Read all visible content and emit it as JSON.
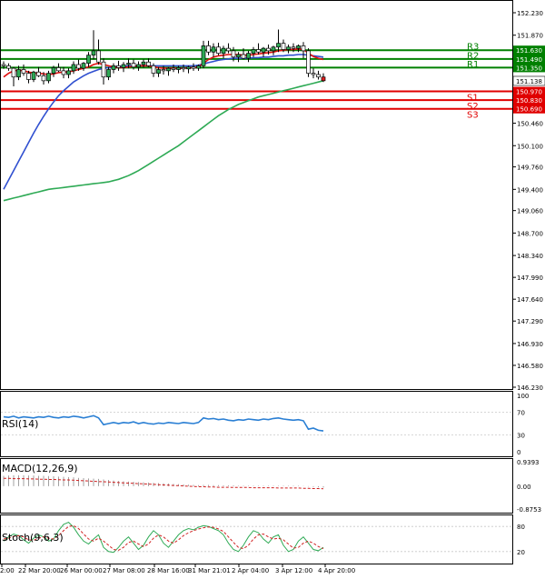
{
  "chart_data": {
    "type": "candlestick",
    "symbol": "USDJPY",
    "price_axis": {
      "ylim": [
        146.23,
        152.23
      ],
      "ticks": [
        "152.230",
        "151.870",
        "151.490",
        "151.130",
        "150.800",
        "150.460",
        "150.100",
        "149.760",
        "149.400",
        "149.060",
        "148.700",
        "148.340",
        "147.990",
        "147.640",
        "147.290",
        "146.930",
        "146.580",
        "146.230"
      ]
    },
    "time_labels": [
      "2:00",
      "22 Mar 20:00",
      "26 Mar 00:00",
      "27 Mar 08:00",
      "28 Mar 16:00",
      "31 Mar 21:01",
      "2 Apr 04:00",
      "3 Apr 12:00",
      "4 Apr 20:00"
    ],
    "levels": [
      {
        "name": "R3",
        "value": 151.63,
        "value_label": "151.630",
        "color": "#008000"
      },
      {
        "name": "R2",
        "value": 151.49,
        "value_label": "151.490",
        "color": "#008000"
      },
      {
        "name": "R1",
        "value": 151.35,
        "value_label": "151.350",
        "color": "#008000"
      },
      {
        "name": "S1",
        "value": 150.97,
        "value_label": "150.970",
        "color": "#e00000"
      },
      {
        "name": "S2",
        "value": 150.83,
        "value_label": "150.830",
        "color": "#e00000"
      },
      {
        "name": "S3",
        "value": 150.69,
        "value_label": "150.690",
        "color": "#e00000"
      }
    ],
    "last_price": {
      "value": 151.138,
      "label": "151.138"
    },
    "candles": [
      [
        151.4,
        151.45,
        151.33,
        151.38
      ],
      [
        151.38,
        151.42,
        151.3,
        151.34
      ],
      [
        151.34,
        151.36,
        151.05,
        151.2
      ],
      [
        151.2,
        151.38,
        151.15,
        151.32
      ],
      [
        151.32,
        151.4,
        151.22,
        151.26
      ],
      [
        151.26,
        151.3,
        151.1,
        151.16
      ],
      [
        151.16,
        151.3,
        151.12,
        151.28
      ],
      [
        151.28,
        151.36,
        151.2,
        151.22
      ],
      [
        151.22,
        151.28,
        151.08,
        151.14
      ],
      [
        151.14,
        151.3,
        151.1,
        151.26
      ],
      [
        151.26,
        151.38,
        151.2,
        151.35
      ],
      [
        151.35,
        151.42,
        151.28,
        151.3
      ],
      [
        151.3,
        151.36,
        151.18,
        151.24
      ],
      [
        151.24,
        151.34,
        151.18,
        151.3
      ],
      [
        151.3,
        151.45,
        151.25,
        151.4
      ],
      [
        151.4,
        151.48,
        151.3,
        151.34
      ],
      [
        151.34,
        151.44,
        151.3,
        151.42
      ],
      [
        151.42,
        151.6,
        151.36,
        151.55
      ],
      [
        151.55,
        151.95,
        151.48,
        151.62
      ],
      [
        151.62,
        151.8,
        151.4,
        151.44
      ],
      [
        151.44,
        151.5,
        151.08,
        151.2
      ],
      [
        151.2,
        151.36,
        151.15,
        151.32
      ],
      [
        151.32,
        151.42,
        151.26,
        151.38
      ],
      [
        151.38,
        151.46,
        151.3,
        151.35
      ],
      [
        151.35,
        151.44,
        151.28,
        151.4
      ],
      [
        151.4,
        151.5,
        151.34,
        151.42
      ],
      [
        151.42,
        151.48,
        151.32,
        151.36
      ],
      [
        151.36,
        151.45,
        151.3,
        151.4
      ],
      [
        151.4,
        151.48,
        151.35,
        151.44
      ],
      [
        151.44,
        151.5,
        151.36,
        151.38
      ],
      [
        151.38,
        151.42,
        151.2,
        151.26
      ],
      [
        151.26,
        151.36,
        151.2,
        151.32
      ],
      [
        151.32,
        151.38,
        151.24,
        151.3
      ],
      [
        151.3,
        151.36,
        151.22,
        151.34
      ],
      [
        151.34,
        151.4,
        151.28,
        151.32
      ],
      [
        151.32,
        151.38,
        151.26,
        151.35
      ],
      [
        151.35,
        151.4,
        151.28,
        151.33
      ],
      [
        151.33,
        151.38,
        151.26,
        151.36
      ],
      [
        151.36,
        151.42,
        151.3,
        151.34
      ],
      [
        151.34,
        151.4,
        151.3,
        151.38
      ],
      [
        151.38,
        151.78,
        151.34,
        151.7
      ],
      [
        151.7,
        151.78,
        151.55,
        151.6
      ],
      [
        151.6,
        151.74,
        151.52,
        151.68
      ],
      [
        151.68,
        151.75,
        151.55,
        151.58
      ],
      [
        151.58,
        151.7,
        151.5,
        151.66
      ],
      [
        151.66,
        151.74,
        151.58,
        151.62
      ],
      [
        151.62,
        151.68,
        151.45,
        151.52
      ],
      [
        151.52,
        151.6,
        151.44,
        151.56
      ],
      [
        151.56,
        151.66,
        151.48,
        151.5
      ],
      [
        151.5,
        151.62,
        151.44,
        151.58
      ],
      [
        151.58,
        151.68,
        151.52,
        151.64
      ],
      [
        151.64,
        151.74,
        151.56,
        151.6
      ],
      [
        151.6,
        151.68,
        151.52,
        151.66
      ],
      [
        151.66,
        151.72,
        151.56,
        151.62
      ],
      [
        151.62,
        151.7,
        151.55,
        151.68
      ],
      [
        151.68,
        151.96,
        151.6,
        151.74
      ],
      [
        151.74,
        151.8,
        151.6,
        151.64
      ],
      [
        151.64,
        151.72,
        151.58,
        151.68
      ],
      [
        151.68,
        151.74,
        151.6,
        151.66
      ],
      [
        151.66,
        151.72,
        151.6,
        151.7
      ],
      [
        151.7,
        151.76,
        151.5,
        151.62
      ],
      [
        151.62,
        151.66,
        151.2,
        151.26
      ],
      [
        151.26,
        151.34,
        151.18,
        151.24
      ],
      [
        151.24,
        151.3,
        151.16,
        151.2
      ],
      [
        151.2,
        151.26,
        151.12,
        151.14
      ]
    ],
    "ma_fast": [
      151.2,
      151.26,
      151.3,
      151.31,
      151.3,
      151.28,
      151.26,
      151.26,
      151.25,
      151.24,
      151.25,
      151.27,
      151.28,
      151.28,
      151.3,
      151.32,
      151.34,
      151.36,
      151.4,
      151.42,
      151.4,
      151.38,
      151.36,
      151.35,
      151.35,
      151.36,
      151.37,
      151.38,
      151.38,
      151.38,
      151.36,
      151.35,
      151.34,
      151.34,
      151.34,
      151.34,
      151.34,
      151.35,
      151.35,
      151.36,
      151.42,
      151.48,
      151.52,
      151.54,
      151.55,
      151.56,
      151.56,
      151.56,
      151.55,
      151.55,
      151.56,
      151.57,
      151.58,
      151.59,
      151.6,
      151.62,
      151.63,
      151.64,
      151.64,
      151.65,
      151.64,
      151.58,
      151.53,
      151.5,
      151.48
    ],
    "ma_mid": [
      149.4,
      149.55,
      149.7,
      149.85,
      150.0,
      150.15,
      150.3,
      150.44,
      150.57,
      150.69,
      150.8,
      150.9,
      150.98,
      151.05,
      151.12,
      151.17,
      151.22,
      151.26,
      151.29,
      151.32,
      151.34,
      151.35,
      151.36,
      151.37,
      151.37,
      151.38,
      151.38,
      151.38,
      151.38,
      151.38,
      151.38,
      151.38,
      151.38,
      151.38,
      151.38,
      151.38,
      151.38,
      151.38,
      151.38,
      151.39,
      151.41,
      151.43,
      151.45,
      151.47,
      151.48,
      151.49,
      151.5,
      151.5,
      151.5,
      151.5,
      151.51,
      151.51,
      151.52,
      151.52,
      151.53,
      151.54,
      151.54,
      151.55,
      151.55,
      151.56,
      151.56,
      151.55,
      151.54,
      151.53,
      151.52
    ],
    "ma_slow": [
      149.22,
      149.24,
      149.26,
      149.28,
      149.3,
      149.32,
      149.34,
      149.36,
      149.38,
      149.4,
      149.41,
      149.42,
      149.43,
      149.44,
      149.45,
      149.46,
      149.47,
      149.48,
      149.49,
      149.5,
      149.51,
      149.52,
      149.54,
      149.56,
      149.59,
      149.62,
      149.66,
      149.7,
      149.75,
      149.8,
      149.85,
      149.9,
      149.95,
      150.0,
      150.05,
      150.1,
      150.16,
      150.22,
      150.28,
      150.34,
      150.4,
      150.46,
      150.52,
      150.58,
      150.63,
      150.68,
      150.72,
      150.76,
      150.79,
      150.82,
      150.85,
      150.88,
      150.9,
      150.92,
      150.94,
      150.96,
      150.98,
      151.0,
      151.02,
      151.04,
      151.06,
      151.08,
      151.1,
      151.12,
      151.14
    ],
    "rsi": {
      "label": "RSI(14)",
      "ticks": [
        "100",
        "70",
        "30",
        "0"
      ],
      "ylim": [
        0,
        100
      ],
      "values": [
        62,
        61,
        63,
        60,
        62,
        61,
        60,
        62,
        61,
        63,
        61,
        60,
        62,
        61,
        63,
        62,
        60,
        62,
        64,
        60,
        48,
        50,
        52,
        50,
        52,
        51,
        53,
        50,
        52,
        50,
        49,
        51,
        50,
        52,
        51,
        50,
        52,
        51,
        50,
        52,
        60,
        58,
        59,
        57,
        58,
        56,
        55,
        57,
        56,
        58,
        57,
        56,
        58,
        57,
        59,
        60,
        58,
        57,
        56,
        57,
        55,
        40,
        42,
        38,
        37
      ]
    },
    "macd": {
      "label": "MACD(12,26,9)",
      "ticks": [
        "0.9393",
        "0.00",
        "-0.8753"
      ],
      "ylim": [
        -0.8753,
        0.9393
      ],
      "histogram": [
        0.4,
        0.41,
        0.42,
        0.42,
        0.42,
        0.41,
        0.41,
        0.4,
        0.4,
        0.39,
        0.38,
        0.37,
        0.36,
        0.35,
        0.34,
        0.32,
        0.31,
        0.3,
        0.29,
        0.28,
        0.26,
        0.24,
        0.22,
        0.2,
        0.19,
        0.18,
        0.17,
        0.16,
        0.15,
        0.14,
        0.13,
        0.12,
        0.11,
        0.1,
        0.09,
        0.08,
        0.07,
        0.06,
        0.05,
        0.04,
        0.05,
        0.05,
        0.04,
        0.04,
        0.03,
        0.03,
        0.03,
        0.02,
        0.02,
        0.02,
        0.02,
        0.02,
        0.02,
        0.02,
        0.02,
        0.02,
        0.02,
        0.02,
        0.02,
        0.02,
        0.01,
        -0.01,
        -0.03,
        -0.04,
        -0.05
      ],
      "signal": [
        0.3,
        0.3,
        0.29,
        0.29,
        0.29,
        0.28,
        0.28,
        0.27,
        0.27,
        0.26,
        0.26,
        0.25,
        0.24,
        0.24,
        0.23,
        0.22,
        0.21,
        0.2,
        0.19,
        0.18,
        0.17,
        0.16,
        0.15,
        0.14,
        0.13,
        0.12,
        0.11,
        0.1,
        0.09,
        0.08,
        0.07,
        0.06,
        0.05,
        0.04,
        0.03,
        0.02,
        0.01,
        0.0,
        -0.01,
        -0.02,
        -0.02,
        -0.03,
        -0.03,
        -0.04,
        -0.04,
        -0.04,
        -0.05,
        -0.05,
        -0.05,
        -0.05,
        -0.06,
        -0.06,
        -0.06,
        -0.06,
        -0.06,
        -0.07,
        -0.07,
        -0.07,
        -0.07,
        -0.07,
        -0.08,
        -0.08,
        -0.09,
        -0.09,
        -0.1
      ]
    },
    "stoch": {
      "label": "Stoch(9,6,3)",
      "ticks": [
        "80",
        "20"
      ],
      "ylim": [
        0,
        100
      ],
      "k": [
        45,
        55,
        62,
        58,
        48,
        40,
        52,
        60,
        55,
        45,
        50,
        70,
        85,
        90,
        78,
        60,
        45,
        38,
        50,
        60,
        30,
        20,
        18,
        30,
        45,
        55,
        40,
        25,
        35,
        55,
        70,
        60,
        40,
        30,
        45,
        60,
        70,
        75,
        72,
        78,
        82,
        80,
        75,
        70,
        60,
        40,
        25,
        20,
        35,
        55,
        70,
        65,
        50,
        40,
        55,
        60,
        35,
        20,
        25,
        45,
        55,
        40,
        25,
        22,
        30
      ],
      "d": [
        50,
        52,
        56,
        58,
        55,
        48,
        47,
        52,
        55,
        52,
        50,
        58,
        70,
        80,
        82,
        75,
        62,
        50,
        45,
        52,
        45,
        35,
        25,
        23,
        30,
        42,
        45,
        38,
        32,
        38,
        52,
        60,
        55,
        45,
        40,
        48,
        58,
        65,
        70,
        74,
        77,
        79,
        78,
        74,
        68,
        55,
        42,
        30,
        27,
        35,
        50,
        60,
        62,
        55,
        50,
        52,
        48,
        38,
        28,
        30,
        40,
        45,
        40,
        32,
        27
      ]
    }
  }
}
